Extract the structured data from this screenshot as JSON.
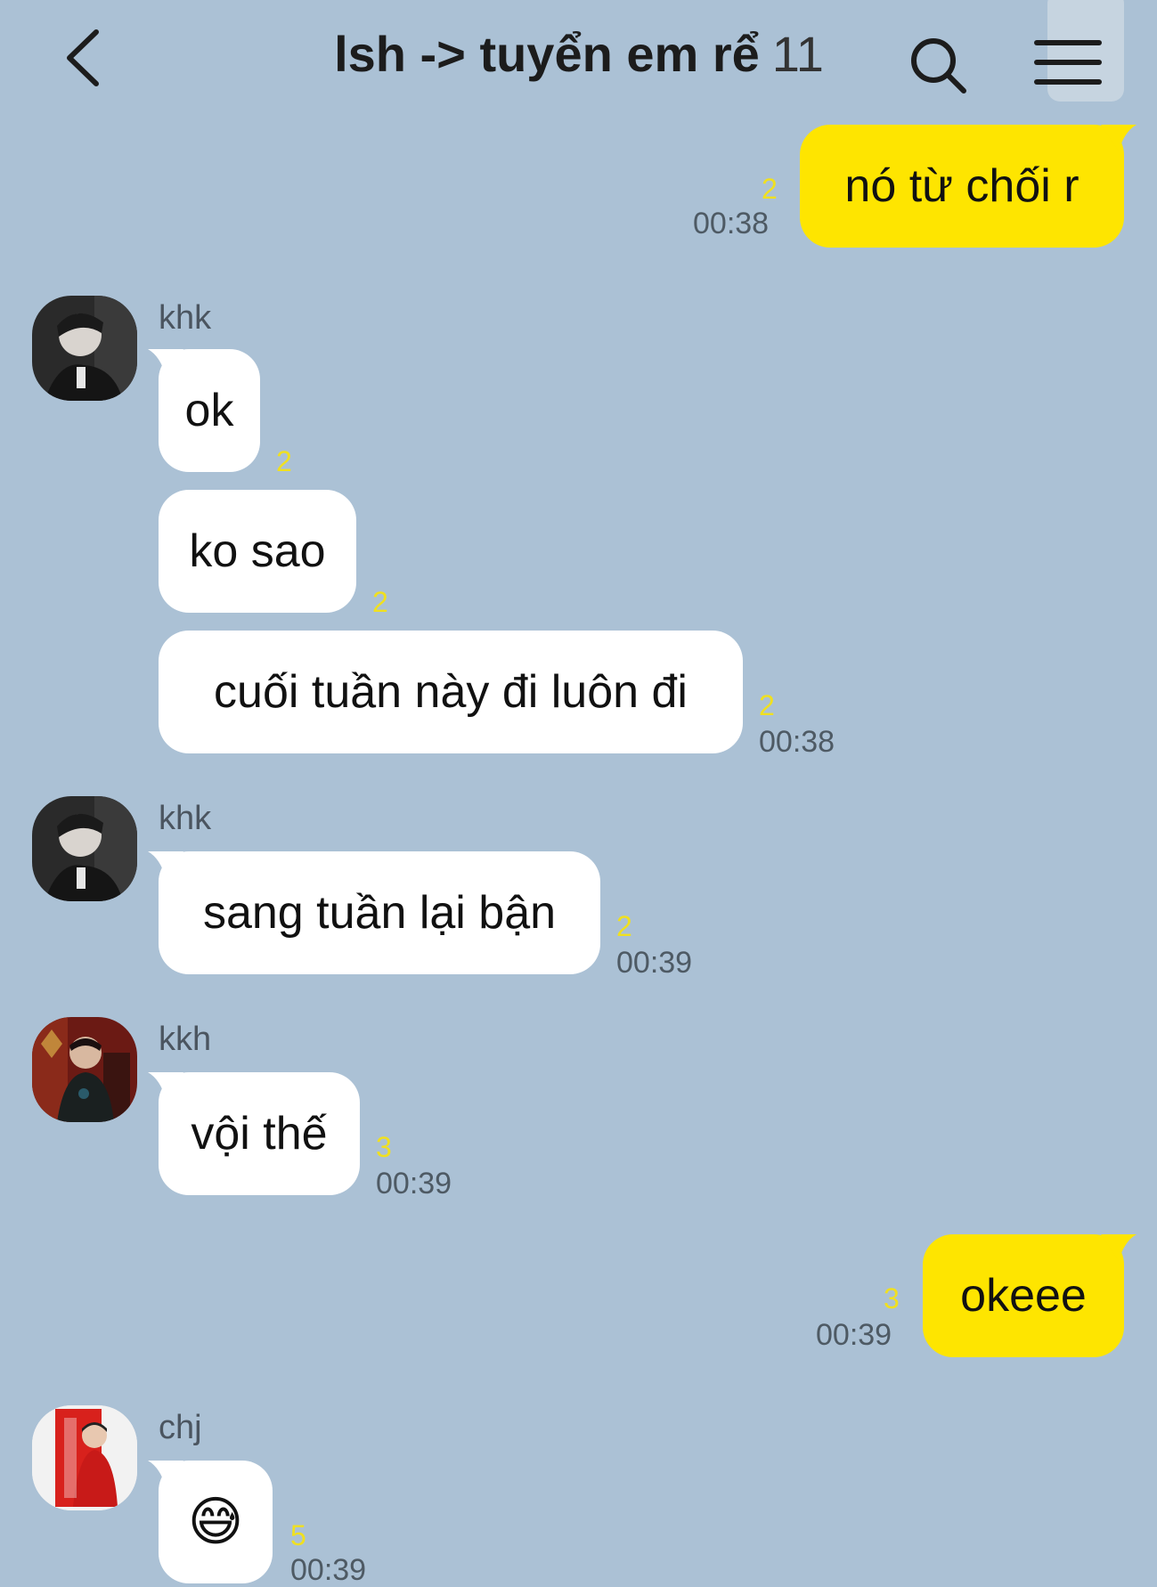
{
  "header": {
    "title": "lsh -> tuyển em rể",
    "member_count": "11",
    "back_icon": "chevron-left-icon",
    "search_icon": "search-icon",
    "menu_icon": "hamburger-menu-icon"
  },
  "colors": {
    "background": "#abc1d5",
    "outgoing_bubble": "#fee500",
    "incoming_bubble": "#ffffff",
    "unread_count": "#f0e020"
  },
  "messages": [
    {
      "direction": "out",
      "text": "nó từ chối r",
      "unread": "2",
      "time": "00:38"
    },
    {
      "direction": "in",
      "sender": "khk",
      "text": "ok",
      "unread": "2"
    },
    {
      "direction": "in",
      "text": "ko sao",
      "unread": "2"
    },
    {
      "direction": "in",
      "text": "cuối tuần này đi luôn đi",
      "unread": "2",
      "time": "00:38"
    },
    {
      "direction": "in",
      "sender": "khk",
      "text": "sang tuần lại bận",
      "unread": "2",
      "time": "00:39"
    },
    {
      "direction": "in",
      "sender": "kkh",
      "text": "vội thế",
      "unread": "3",
      "time": "00:39"
    },
    {
      "direction": "out",
      "text": "okeee",
      "unread": "3",
      "time": "00:39"
    },
    {
      "direction": "in",
      "sender": "chj",
      "text": "😅",
      "unread": "5",
      "time": "00:39"
    }
  ]
}
